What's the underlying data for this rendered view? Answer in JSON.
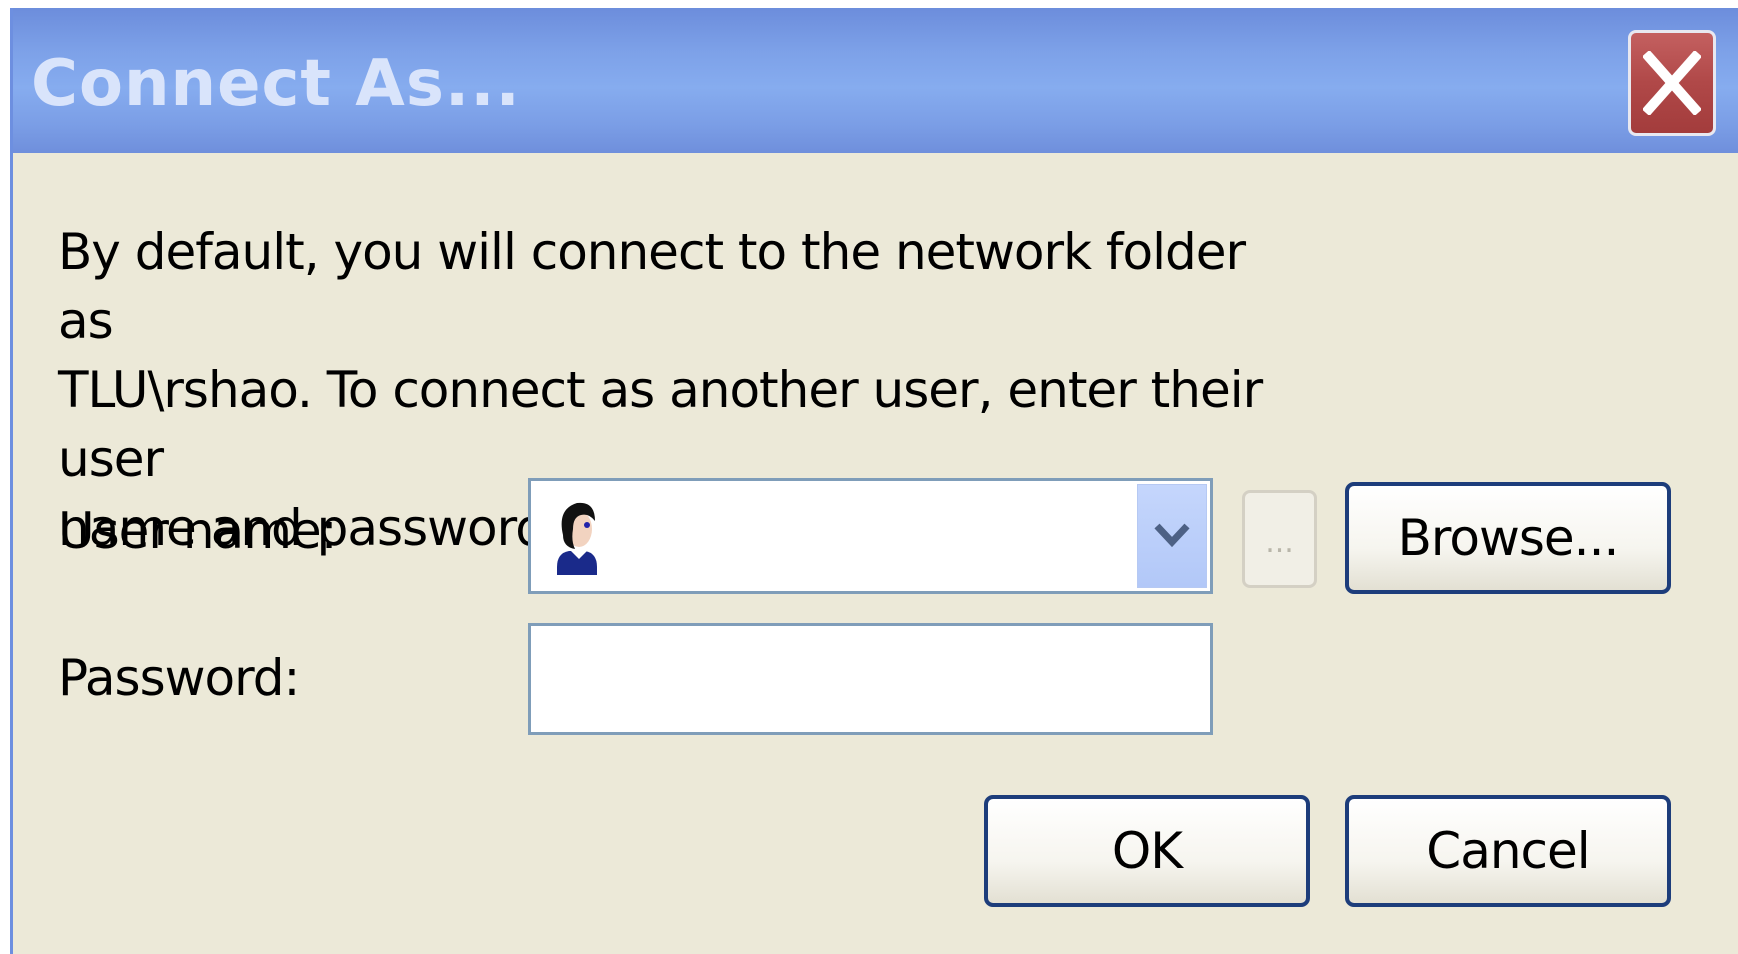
{
  "window": {
    "title": "Connect As...",
    "close_icon": "close-icon"
  },
  "message": {
    "line1": "By default, you will connect to the network folder as",
    "line2": "TLU\\rshao. To connect as another user, enter their user",
    "line3": "name and password below."
  },
  "form": {
    "username_label": "User name:",
    "username_value": "",
    "username_icon": "user-avatar-icon",
    "dropdown_icon": "chevron-down-icon",
    "dots_label": "...",
    "browse_label": "Browse...",
    "password_label": "Password:",
    "password_value": ""
  },
  "buttons": {
    "ok_label": "OK",
    "cancel_label": "Cancel"
  },
  "colors": {
    "titlebar": "#7da1e8",
    "close_button": "#b04848",
    "dialog_background": "#ece9d8",
    "button_border": "#1d3d7b"
  }
}
